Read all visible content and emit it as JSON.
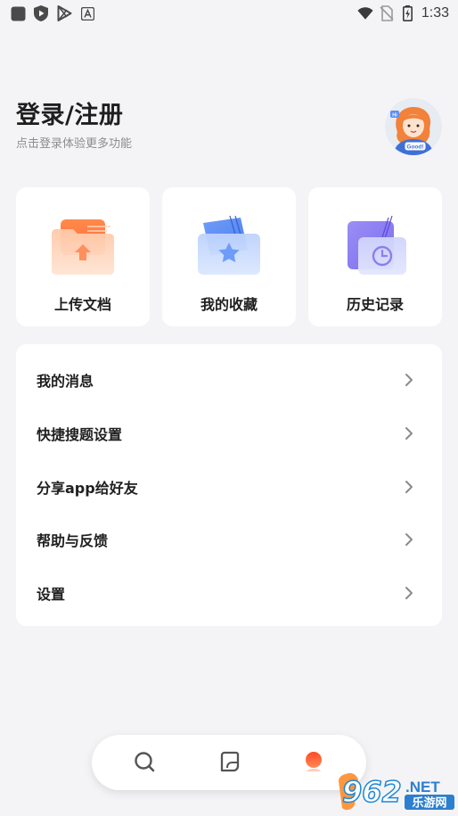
{
  "status_bar": {
    "time": "1:33",
    "left_icons": [
      "app-square-icon",
      "play-protect-icon",
      "play-store-icon",
      "translate-a-icon"
    ],
    "right_icons": [
      "wifi-icon",
      "no-sim-icon",
      "battery-charging-icon"
    ]
  },
  "header": {
    "title": "登录/注册",
    "subtitle": "点击登录体验更多功能",
    "avatar_text": "Good!",
    "avatar_hi": "Hi"
  },
  "quick_actions": [
    {
      "label": "上传文档",
      "icon": "upload-folder-icon"
    },
    {
      "label": "我的收藏",
      "icon": "star-folder-icon"
    },
    {
      "label": "历史记录",
      "icon": "history-clock-icon"
    }
  ],
  "menu": [
    {
      "label": "我的消息",
      "icon": "chevron-right-icon"
    },
    {
      "label": "快捷搜题设置",
      "icon": "chevron-right-icon"
    },
    {
      "label": "分享app给好友",
      "icon": "chevron-right-icon"
    },
    {
      "label": "帮助与反馈",
      "icon": "chevron-right-icon"
    },
    {
      "label": "设置",
      "icon": "chevron-right-icon"
    }
  ],
  "bottom_nav": {
    "items": [
      "search-icon",
      "notebook-icon",
      "profile-icon"
    ],
    "active_index": 2
  },
  "watermark": {
    "brand": "962",
    "domain": ".NET",
    "site": "乐游网"
  },
  "colors": {
    "background": "#f4f4f6",
    "card": "#ffffff",
    "accent_orange": "#ff5b2e",
    "upload_orange": "#ff8a55",
    "favorite_blue": "#5b8ff5",
    "history_purple": "#8b7ef0"
  }
}
